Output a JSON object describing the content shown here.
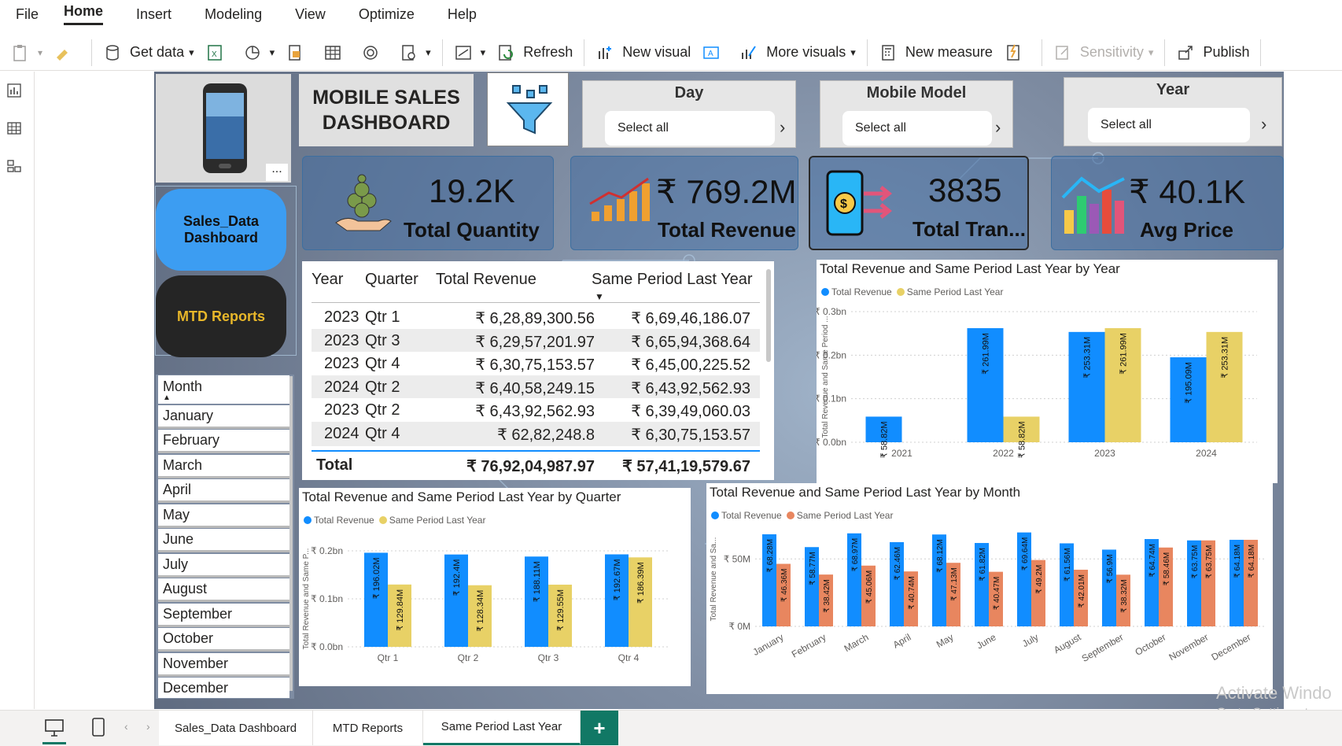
{
  "menu": {
    "items": [
      "File",
      "Home",
      "Insert",
      "Modeling",
      "View",
      "Optimize",
      "Help"
    ],
    "active": "Home"
  },
  "ribbon": {
    "get_data": "Get data",
    "refresh": "Refresh",
    "new_visual": "New visual",
    "more_visuals": "More visuals",
    "new_measure": "New measure",
    "sensitivity": "Sensitivity",
    "publish": "Publish"
  },
  "dashboard": {
    "title_line1": "MOBILE SALES",
    "title_line2": "DASHBOARD",
    "more_options": "...",
    "nav_sales": "Sales_Data Dashboard",
    "nav_mtd": "MTD Reports"
  },
  "slicers": [
    {
      "title": "Day",
      "value": "Select all"
    },
    {
      "title": "Mobile Model",
      "value": "Select all"
    },
    {
      "title": "Year",
      "value": "Select all"
    }
  ],
  "kpis": [
    {
      "value": "19.2K",
      "label": "Total Quantity"
    },
    {
      "value": "₹ 769.2M",
      "label": "Total Revenue"
    },
    {
      "value": "3835",
      "label": "Total Tran..."
    },
    {
      "value": "₹ 40.1K",
      "label": "Avg Price"
    }
  ],
  "month_slicer": {
    "header": "Month",
    "items": [
      "January",
      "February",
      "March",
      "April",
      "May",
      "June",
      "July",
      "August",
      "September",
      "October",
      "November",
      "December"
    ]
  },
  "table": {
    "headers": [
      "Year",
      "Quarter",
      "Total Revenue",
      "Same Period Last Year"
    ],
    "rows": [
      [
        "2023",
        "Qtr 1",
        "₹ 6,28,89,300.56",
        "₹ 6,69,46,186.07"
      ],
      [
        "2023",
        "Qtr 3",
        "₹ 6,29,57,201.97",
        "₹ 6,65,94,368.64"
      ],
      [
        "2023",
        "Qtr 4",
        "₹ 6,30,75,153.57",
        "₹ 6,45,00,225.52"
      ],
      [
        "2024",
        "Qtr 2",
        "₹ 6,40,58,249.15",
        "₹ 6,43,92,562.93"
      ],
      [
        "2023",
        "Qtr 2",
        "₹ 6,43,92,562.93",
        "₹ 6,39,49,060.03"
      ],
      [
        "2024",
        "Qtr 4",
        "₹ 62,82,248.8",
        "₹ 6,30,75,153.57"
      ]
    ],
    "total_label": "Total",
    "total_revenue": "₹ 76,92,04,987.97",
    "total_sply": "₹ 57,41,19,579.67"
  },
  "colors": {
    "total_revenue": "#118dff",
    "sply_yellow": "#e8d166",
    "sply_orange": "#e8865f"
  },
  "chart_data": [
    {
      "type": "bar",
      "title": "Total Revenue and Same Period Last Year by Year",
      "ylabel": "Total Revenue and Same Period ...",
      "categories": [
        "2021",
        "2022",
        "2023",
        "2024"
      ],
      "yticks": [
        "₹ 0.0bn",
        "₹ 0.1bn",
        "₹ 0.2bn",
        "₹ 0.3bn"
      ],
      "ylim": [
        0,
        0.3
      ],
      "series": [
        {
          "name": "Total Revenue",
          "values": [
            0.05882,
            0.26199,
            0.25331,
            0.19509
          ],
          "labels": [
            "₹ 58.82M",
            "₹ 261.99M",
            "₹ 253.31M",
            "₹ 195.09M"
          ]
        },
        {
          "name": "Same Period Last Year",
          "values": [
            null,
            0.05882,
            0.26199,
            0.25331
          ],
          "labels": [
            "",
            "₹ 58.82M",
            "₹ 261.99M",
            "₹ 253.31M"
          ]
        }
      ]
    },
    {
      "type": "bar",
      "title": "Total Revenue and Same Period Last Year by Quarter",
      "ylabel": "Total Revenue and Same P...",
      "categories": [
        "Qtr 1",
        "Qtr 2",
        "Qtr 3",
        "Qtr 4"
      ],
      "yticks": [
        "₹ 0.0bn",
        "₹ 0.1bn",
        "₹ 0.2bn"
      ],
      "ylim": [
        0,
        0.2
      ],
      "series": [
        {
          "name": "Total Revenue",
          "values": [
            0.19602,
            0.1924,
            0.18811,
            0.19267
          ],
          "labels": [
            "₹ 196.02M",
            "₹ 192.4M",
            "₹ 188.11M",
            "₹ 192.67M"
          ]
        },
        {
          "name": "Same Period Last Year",
          "values": [
            0.12984,
            0.12834,
            0.12955,
            0.18639
          ],
          "labels": [
            "₹ 129.84M",
            "₹ 128.34M",
            "₹ 129.55M",
            "₹ 186.39M"
          ]
        }
      ]
    },
    {
      "type": "bar",
      "title": "Total Revenue and Same Period Last Year by Month",
      "ylabel": "Total Revenue and Sa...",
      "categories": [
        "January",
        "February",
        "March",
        "April",
        "May",
        "June",
        "July",
        "August",
        "September",
        "October",
        "November",
        "December"
      ],
      "yticks": [
        "₹ 0M",
        "₹ 50M"
      ],
      "ylim": [
        0,
        70
      ],
      "series": [
        {
          "name": "Total Revenue",
          "values": [
            68.28,
            58.77,
            68.97,
            62.46,
            68.12,
            61.82,
            69.64,
            61.56,
            56.9,
            64.74,
            63.75,
            64.18
          ],
          "labels": [
            "₹ 68.28M",
            "₹ 58.77M",
            "₹ 68.97M",
            "₹ 62.46M",
            "₹ 68.12M",
            "₹ 61.82M",
            "₹ 69.64M",
            "₹ 61.56M",
            "₹ 56.9M",
            "₹ 64.74M",
            "₹ 63.75M",
            "₹ 64.18M"
          ]
        },
        {
          "name": "Same Period Last Year",
          "values": [
            46.36,
            38.42,
            45.06,
            40.74,
            47.13,
            40.47,
            49.2,
            42.01,
            38.32,
            58.46,
            63.75,
            64.18
          ],
          "labels": [
            "₹ 46.36M",
            "₹ 38.42M",
            "₹ 45.06M",
            "₹ 40.74M",
            "₹ 47.13M",
            "₹ 40.47M",
            "₹ 49.2M",
            "₹ 42.01M",
            "₹ 38.32M",
            "₹ 58.46M",
            "₹ 63.75M",
            "₹ 64.18M"
          ]
        }
      ]
    }
  ],
  "page_tabs": [
    "Sales_Data Dashboard",
    "MTD Reports",
    "Same Period Last Year"
  ],
  "active_tab": "Same Period Last Year",
  "add_page": "+",
  "watermark": {
    "line1": "Activate Windo",
    "line2": "Go to Settings to ac"
  }
}
